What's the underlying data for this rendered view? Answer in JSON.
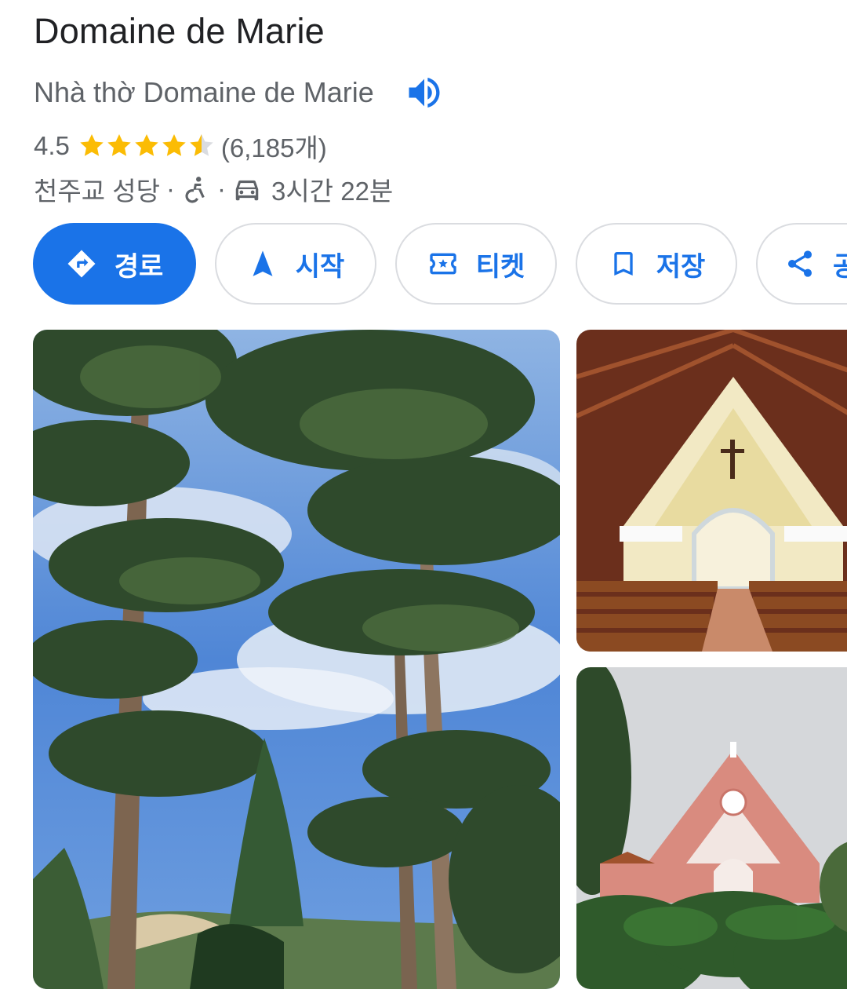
{
  "place": {
    "title": "Domaine de Marie",
    "subtitle": "Nhà thờ Domaine de Marie",
    "rating": "4.5",
    "stars": 4.5,
    "reviews": "(6,185개)",
    "category": "천주교 성당",
    "separator": "·",
    "drive_time": "3시간 22분"
  },
  "icons": {
    "speaker": "volume-up-icon",
    "accessibility": "wheelchair-icon",
    "car": "car-icon"
  },
  "actions": {
    "directions": "경로",
    "start": "시작",
    "tickets": "티켓",
    "save": "저장",
    "share": "공유"
  },
  "colors": {
    "accent": "#1a73e8",
    "star": "#fbbc04",
    "secondary_text": "#5f6368"
  }
}
